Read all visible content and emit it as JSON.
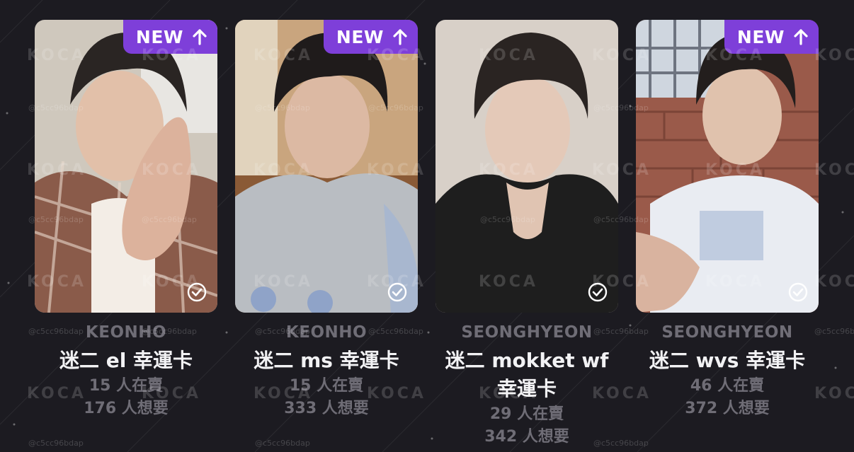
{
  "badge": {
    "label": "NEW"
  },
  "watermark": {
    "brand": "KOCA",
    "id": "@c5cc96bdap"
  },
  "cards": [
    {
      "artist": "KEONHO",
      "title": "迷二 el 幸運卡",
      "selling": "15 人在賣",
      "wanted": "176 人想要",
      "is_new": true
    },
    {
      "artist": "KEONHO",
      "title": "迷二 ms 幸運卡",
      "selling": "15 人在賣",
      "wanted": "333 人想要",
      "is_new": true
    },
    {
      "artist": "SEONGHYEON",
      "title": "迷二 mokket wf 幸運卡",
      "selling": "29 人在賣",
      "wanted": "342 人想要",
      "is_new": false
    },
    {
      "artist": "SEONGHYEON",
      "title": "迷二 wvs 幸運卡",
      "selling": "46 人在賣",
      "wanted": "372 人想要",
      "is_new": true
    }
  ],
  "colors": {
    "background": "#1c1b21",
    "badge": "#7e3fd9",
    "muted_text": "#6f6d76",
    "title_text": "#f2f2f4"
  }
}
